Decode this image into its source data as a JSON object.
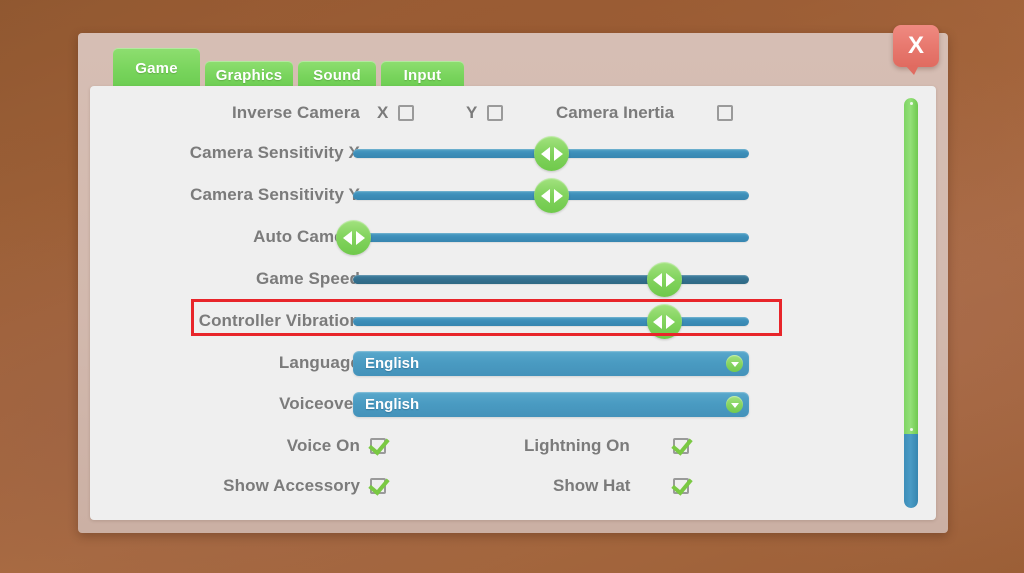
{
  "window": {
    "close_label": "X"
  },
  "tabs": [
    {
      "label": "Game",
      "active": true
    },
    {
      "label": "Graphics",
      "active": false
    },
    {
      "label": "Sound",
      "active": false
    },
    {
      "label": "Input",
      "active": false
    }
  ],
  "settings": {
    "inverse_camera": {
      "label": "Inverse Camera",
      "x_label": "X",
      "x_checked": false,
      "y_label": "Y",
      "y_checked": false
    },
    "camera_inertia": {
      "label": "Camera Inertia",
      "checked": false
    },
    "sliders": [
      {
        "label": "Camera Sensitivity X",
        "value_pct": 50,
        "highlighted": false,
        "active": false
      },
      {
        "label": "Camera Sensitivity Y",
        "value_pct": 50,
        "highlighted": false,
        "active": false
      },
      {
        "label": "Auto Camera",
        "value_pct": 0,
        "highlighted": false,
        "active": false
      },
      {
        "label": "Game Speed",
        "value_pct": 78.5,
        "highlighted": true,
        "active": true
      },
      {
        "label": "Controller Vibration",
        "value_pct": 78.5,
        "highlighted": false,
        "active": false
      }
    ],
    "dropdowns": [
      {
        "label": "Language",
        "value": "English"
      },
      {
        "label": "Voiceover",
        "value": "English"
      }
    ],
    "toggles": [
      {
        "label": "Voice On",
        "checked": true,
        "right_label": "Lightning On",
        "right_checked": true
      },
      {
        "label": "Show Accessory",
        "checked": true,
        "right_label": "Show Hat",
        "right_checked": true
      }
    ]
  },
  "scrollbar": {
    "thumb_top_pct": 82,
    "thumb_bottom_pct": 18
  },
  "colors": {
    "accent_green": "#7ed463",
    "accent_blue": "#3d8eb9",
    "accent_blue_active": "#34708f",
    "close_red": "#e06b60",
    "highlight_red": "#e8252a",
    "background_brown": "#a0613a",
    "panel_bg": "#efefef",
    "frame_bg": "#d2b9ae",
    "label_gray": "#7b7b7b"
  }
}
